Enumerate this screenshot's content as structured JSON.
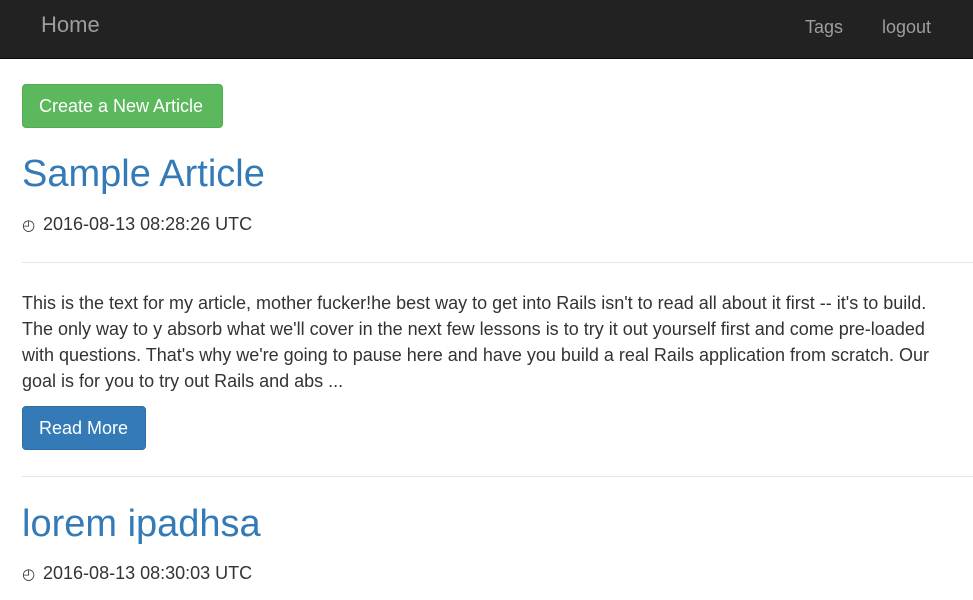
{
  "navbar": {
    "brand": "Home",
    "links": [
      "Tags",
      "logout"
    ]
  },
  "actions": {
    "create_label": "Create a New Article"
  },
  "articles": [
    {
      "title": "Sample Article",
      "timestamp": "2016-08-13 08:28:26 UTC",
      "excerpt": "This is the text for my article, mother fucker!he best way to get into Rails isn't to read all about it first -- it's to build. The only way to y absorb what we'll cover in the next few lessons is to try it out yourself first and come pre-loaded with questions. That's why we're going to pause here and have you build a real Rails application from scratch. Our goal is for you to try out Rails and abs ...",
      "read_more": "Read More"
    },
    {
      "title": "lorem ipadhsa",
      "timestamp": "2016-08-13 08:30:03 UTC"
    }
  ],
  "icons": {
    "clock": "clock-icon"
  },
  "colors": {
    "navbar_bg": "#222222",
    "link": "#337ab7",
    "success": "#5cb85c",
    "primary": "#337ab7"
  }
}
